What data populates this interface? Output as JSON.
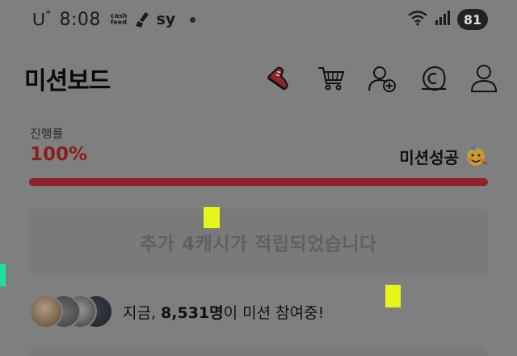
{
  "status_bar": {
    "carrier": "U",
    "carrier_sup": "+",
    "time": "8:08",
    "cashfeed_top": "cash",
    "cashfeed_bottom": "feed",
    "sy": "sy",
    "battery": "81",
    "icons": [
      "cashfeed-logo",
      "clean-icon",
      "wifi-icon",
      "signal-icon",
      "battery-icon"
    ]
  },
  "header": {
    "title": "미션보드",
    "icons": [
      "sneaker-icon",
      "cart-icon",
      "add-user-icon",
      "coin-icon",
      "profile-icon"
    ]
  },
  "progress": {
    "label": "진행률",
    "value_text": "100%",
    "value": 1.0,
    "status_text": "미션성공",
    "status_emoji": "party-face-icon"
  },
  "reward": {
    "message": "추가 4캐시가 적립되었습니다"
  },
  "participants": {
    "prefix": "지금, ",
    "count": "8,531명",
    "suffix": "이 미션 참여중!"
  },
  "colors": {
    "accent": "#8f2424",
    "background": "#7f7f7f",
    "marker": "#e6f51a",
    "marker_left": "#1ee0a0"
  }
}
